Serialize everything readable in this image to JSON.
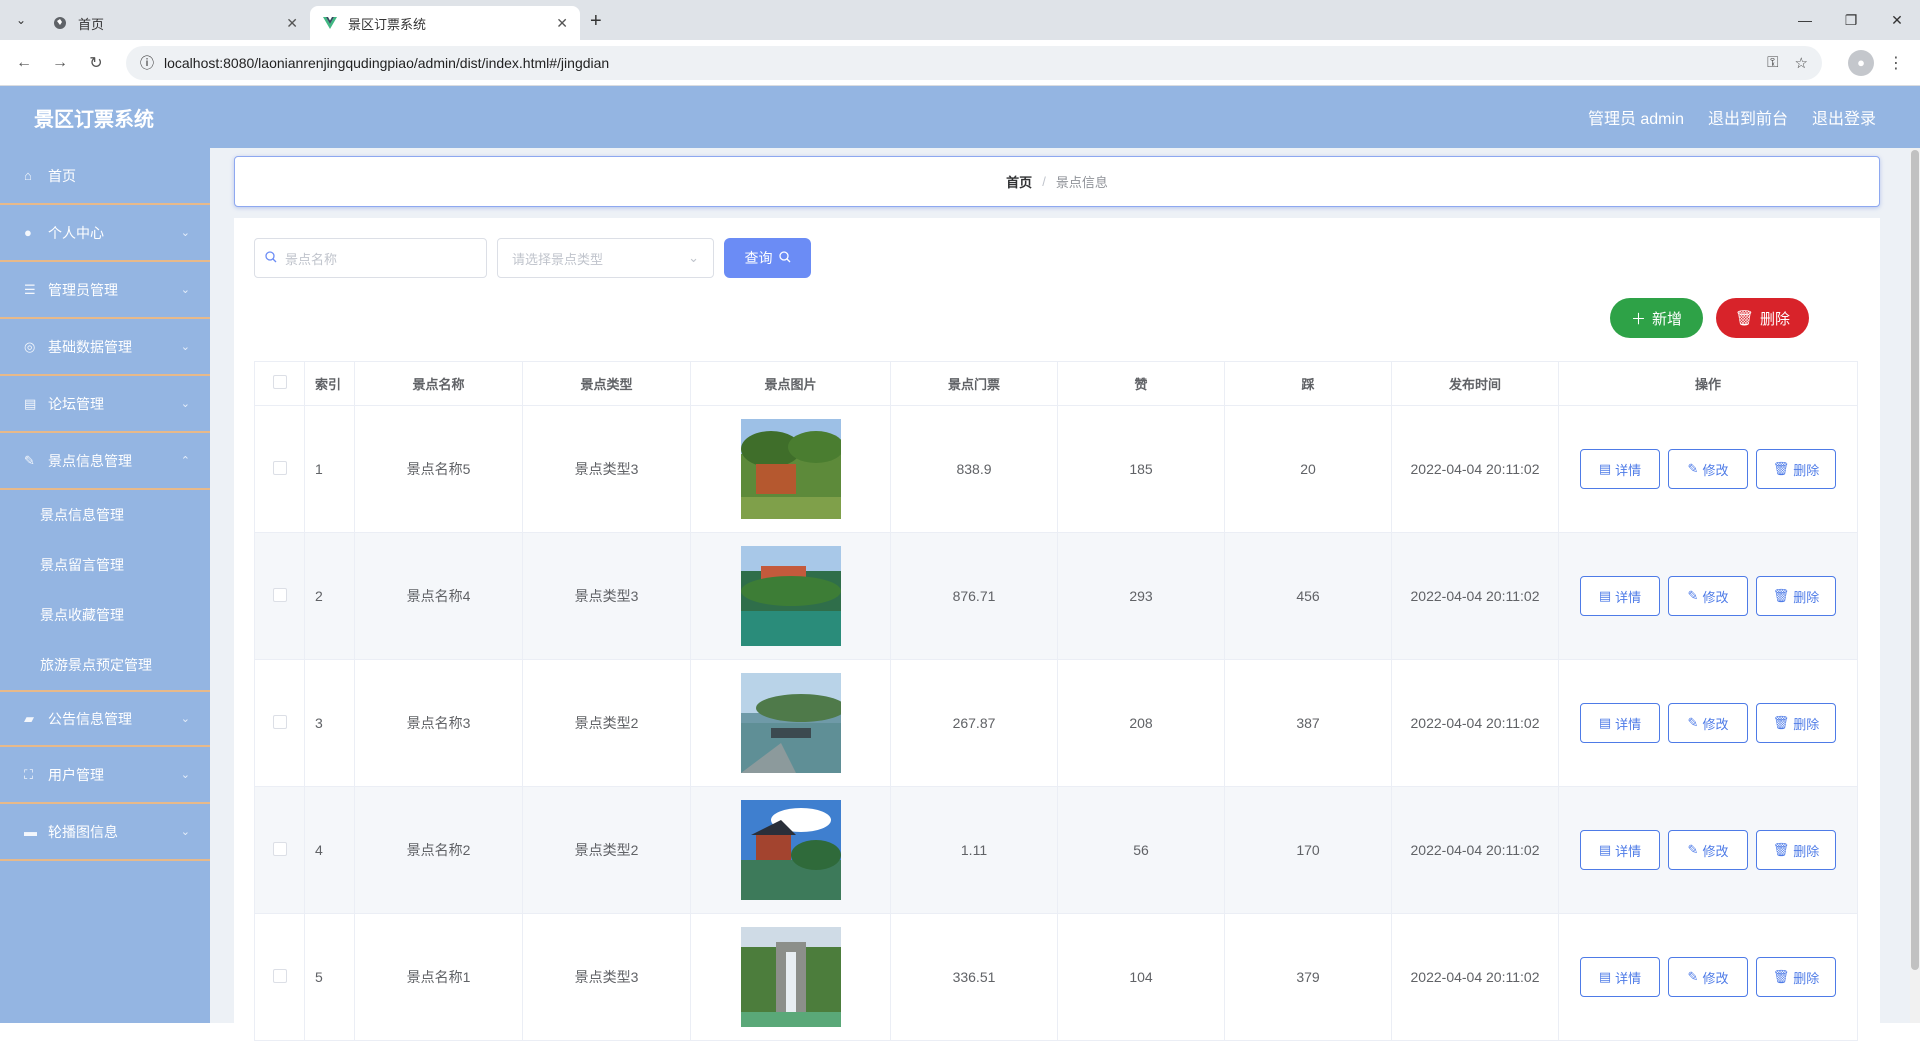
{
  "browser": {
    "tabs": [
      {
        "title": "首页",
        "active": false
      },
      {
        "title": "景区订票系统",
        "active": true
      }
    ],
    "url": "localhost:8080/laonianrenjingqudingpiao/admin/dist/index.html#/jingdian"
  },
  "header": {
    "title": "景区订票系统",
    "admin_label": "管理员 admin",
    "front_link": "退出到前台",
    "logout_link": "退出登录"
  },
  "sidebar": {
    "items": [
      {
        "label": "首页",
        "icon": "home-icon"
      },
      {
        "label": "个人中心",
        "icon": "user-icon"
      },
      {
        "label": "管理员管理",
        "icon": "sliders-icon"
      },
      {
        "label": "基础数据管理",
        "icon": "globe-icon"
      },
      {
        "label": "论坛管理",
        "icon": "book-icon"
      },
      {
        "label": "景点信息管理",
        "icon": "edit-icon"
      },
      {
        "label": "公告信息管理",
        "icon": "bag-icon"
      },
      {
        "label": "用户管理",
        "icon": "scan-icon"
      },
      {
        "label": "轮播图信息",
        "icon": "briefcase-icon"
      }
    ],
    "subitems": [
      "景点信息管理",
      "景点留言管理",
      "景点收藏管理",
      "旅游景点预定管理"
    ]
  },
  "breadcrumb": {
    "home": "首页",
    "current": "景点信息"
  },
  "search": {
    "name_placeholder": "景点名称",
    "type_placeholder": "请选择景点类型",
    "query_label": "查询"
  },
  "actions": {
    "add_label": "新增",
    "delete_label": "删除"
  },
  "table": {
    "headers": [
      "索引",
      "景点名称",
      "景点类型",
      "景点图片",
      "景点门票",
      "赞",
      "踩",
      "发布时间",
      "操作"
    ],
    "rows": [
      {
        "index": "1",
        "name": "景点名称5",
        "type": "景点类型3",
        "price": "838.9",
        "like": "185",
        "dislike": "20",
        "time": "2022-04-04 20:11:02"
      },
      {
        "index": "2",
        "name": "景点名称4",
        "type": "景点类型3",
        "price": "876.71",
        "like": "293",
        "dislike": "456",
        "time": "2022-04-04 20:11:02"
      },
      {
        "index": "3",
        "name": "景点名称3",
        "type": "景点类型2",
        "price": "267.87",
        "like": "208",
        "dislike": "387",
        "time": "2022-04-04 20:11:02"
      },
      {
        "index": "4",
        "name": "景点名称2",
        "type": "景点类型2",
        "price": "1.11",
        "like": "56",
        "dislike": "170",
        "time": "2022-04-04 20:11:02"
      },
      {
        "index": "5",
        "name": "景点名称1",
        "type": "景点类型3",
        "price": "336.51",
        "like": "104",
        "dislike": "379",
        "time": "2022-04-04 20:11:02"
      }
    ],
    "op_labels": {
      "detail": "详情",
      "edit": "修改",
      "delete": "删除"
    }
  },
  "colors": {
    "header_bg": "#94b5e2",
    "accent": "#6b8cf5",
    "add_green": "#2ea247",
    "delete_red": "#d8232a"
  }
}
